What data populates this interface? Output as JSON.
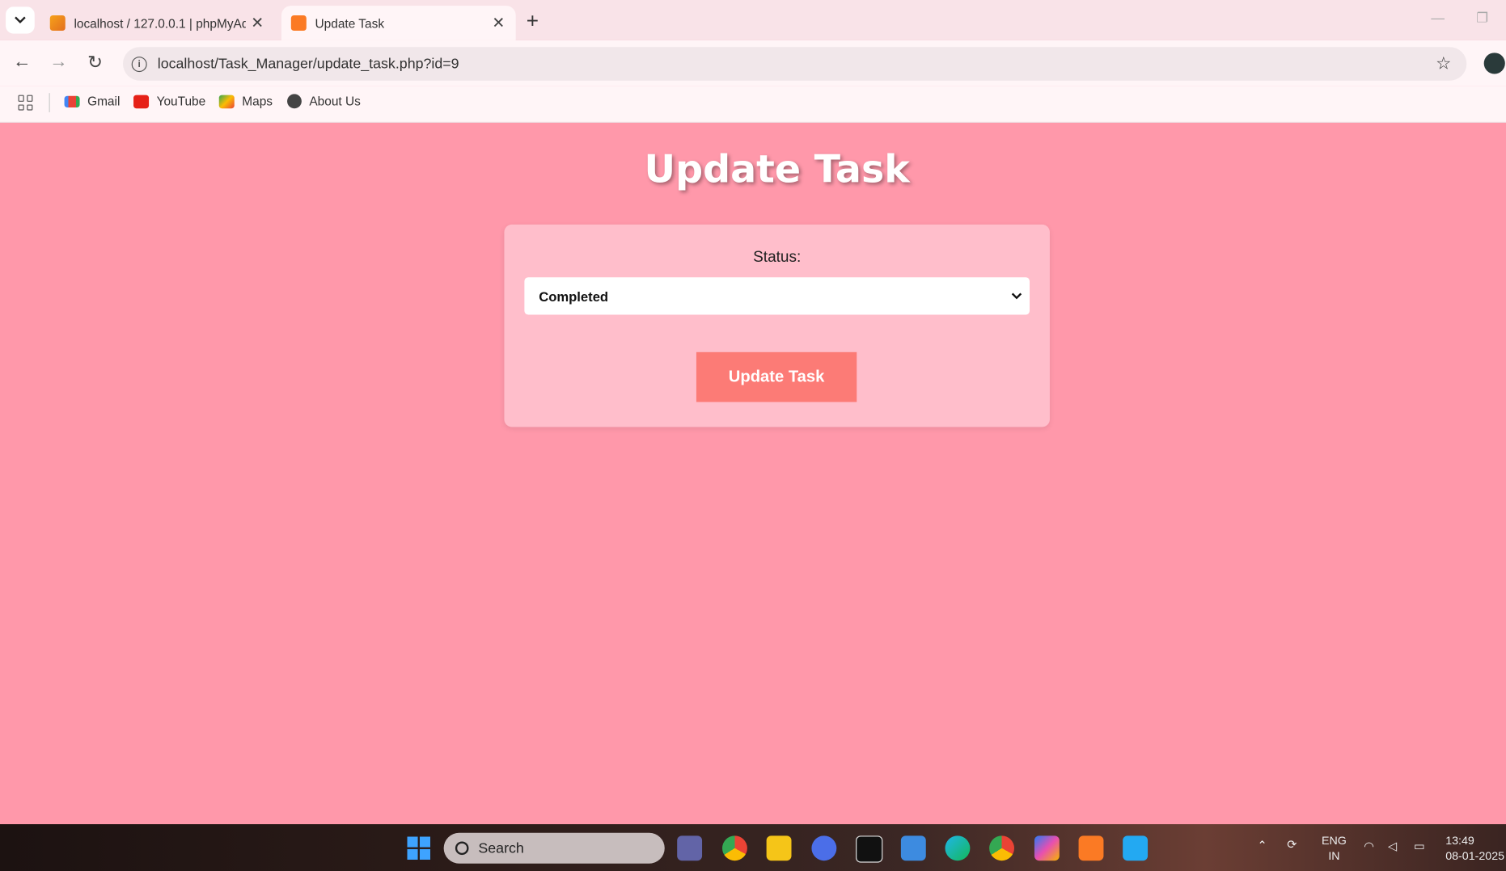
{
  "browser": {
    "tabs": [
      {
        "title": "localhost / 127.0.0.1 | phpMyAdmin",
        "favicon": "phpmyadmin-icon"
      },
      {
        "title": "Update Task",
        "favicon": "xampp-icon",
        "active": true
      }
    ],
    "url": "localhost/Task_Manager/update_task.php?id=9",
    "bookmarks": [
      {
        "label": "Gmail",
        "icon": "gmail-icon"
      },
      {
        "label": "YouTube",
        "icon": "youtube-icon"
      },
      {
        "label": "Maps",
        "icon": "maps-icon"
      },
      {
        "label": "About Us",
        "icon": "globe-icon"
      }
    ]
  },
  "page": {
    "title": "Update Task",
    "form": {
      "status_label": "Status:",
      "status_value": "Completed",
      "submit_label": "Update Task"
    }
  },
  "taskbar": {
    "search_placeholder": "Search",
    "lang_line1": "ENG",
    "lang_line2": "IN",
    "time": "13:49",
    "date": "08-01-2025"
  },
  "colors": {
    "page_bg": "#ff98aa",
    "card_bg": "#ffbecb",
    "button_bg": "#fc7b76"
  }
}
